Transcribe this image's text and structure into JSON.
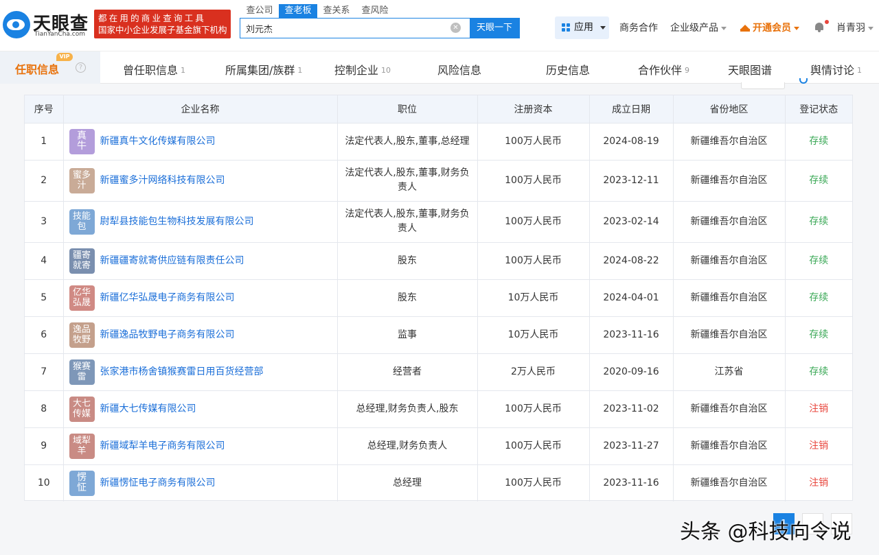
{
  "brand": {
    "name_cn": "天眼查",
    "name_en": "TianYanCha.com",
    "slogan_line1": "都在用的商业查询工具",
    "slogan_line2": "国家中小企业发展子基金旗下机构",
    "accent_color": "#1a82e2",
    "slogan_color": "#d9301f"
  },
  "search": {
    "tabs": [
      "查公司",
      "查老板",
      "查关系",
      "查风险"
    ],
    "active_tab": "查老板",
    "value": "刘元杰",
    "button_label": "天眼一下"
  },
  "nav": {
    "app_label": "应用",
    "biz_coop": "商务合作",
    "enterprise_products": "企业级产品",
    "vip": "开通会员",
    "user_name": "肖青羽"
  },
  "tabs": {
    "current": {
      "label": "任职信息",
      "badge": "VIP"
    },
    "items": [
      {
        "label": "曾任职信息",
        "count": "1"
      },
      {
        "label": "所属集团/族群",
        "count": "1"
      },
      {
        "label": "控制企业",
        "count": "10"
      },
      {
        "label": "风险信息",
        "count": ""
      },
      {
        "label": "历史信息",
        "count": ""
      },
      {
        "label": "合作伙伴",
        "count": "9"
      },
      {
        "label": "天眼图谱",
        "count": ""
      },
      {
        "label": "舆情讨论",
        "count": "1"
      }
    ]
  },
  "table": {
    "columns": [
      "序号",
      "企业名称",
      "职位",
      "注册资本",
      "成立日期",
      "省份地区",
      "登记状态"
    ],
    "rows": [
      {
        "no": "1",
        "avatar": "真牛",
        "avatar_color": "#b39ddb",
        "name": "新疆真牛文化传媒有限公司",
        "role": "法定代表人,股东,董事,总经理",
        "capital": "100万人民币",
        "date": "2024-08-19",
        "region": "新疆维吾尔自治区",
        "status": "存续"
      },
      {
        "no": "2",
        "avatar": "蜜多汁",
        "avatar_color": "#c9ab97",
        "name": "新疆蜜多汁网络科技有限公司",
        "role": "法定代表人,股东,董事,财务负责人",
        "capital": "100万人民币",
        "date": "2023-12-11",
        "region": "新疆维吾尔自治区",
        "status": "存续"
      },
      {
        "no": "3",
        "avatar": "技能包",
        "avatar_color": "#7ea8d6",
        "name": "尉犁县技能包生物科技发展有限公司",
        "role": "法定代表人,股东,董事,财务负责人",
        "capital": "100万人民币",
        "date": "2023-02-14",
        "region": "新疆维吾尔自治区",
        "status": "存续"
      },
      {
        "no": "4",
        "avatar": "疆寄就寄",
        "avatar_color": "#7a8faf",
        "name": "新疆疆寄就寄供应链有限责任公司",
        "role": "股东",
        "capital": "100万人民币",
        "date": "2024-08-22",
        "region": "新疆维吾尔自治区",
        "status": "存续"
      },
      {
        "no": "5",
        "avatar": "亿华弘晟",
        "avatar_color": "#d08a84",
        "name": "新疆亿华弘晟电子商务有限公司",
        "role": "股东",
        "capital": "10万人民币",
        "date": "2024-04-01",
        "region": "新疆维吾尔自治区",
        "status": "存续"
      },
      {
        "no": "6",
        "avatar": "逸品牧野",
        "avatar_color": "#c4a08c",
        "name": "新疆逸品牧野电子商务有限公司",
        "role": "监事",
        "capital": "10万人民币",
        "date": "2023-11-16",
        "region": "新疆维吾尔自治区",
        "status": "存续"
      },
      {
        "no": "7",
        "avatar": "猴赛雷",
        "avatar_color": "#7e97b8",
        "name": "张家港市杨舍镇猴赛雷日用百货经营部",
        "role": "经营者",
        "capital": "2万人民币",
        "date": "2020-09-16",
        "region": "江苏省",
        "status": "存续"
      },
      {
        "no": "8",
        "avatar": "大七传媒",
        "avatar_color": "#c98b84",
        "name": "新疆大七传媒有限公司",
        "role": "总经理,财务负责人,股东",
        "capital": "100万人民币",
        "date": "2023-11-02",
        "region": "新疆维吾尔自治区",
        "status": "注销"
      },
      {
        "no": "9",
        "avatar": "域犁羊",
        "avatar_color": "#c98b84",
        "name": "新疆域犁羊电子商务有限公司",
        "role": "总经理,财务负责人",
        "capital": "100万人民币",
        "date": "2023-11-27",
        "region": "新疆维吾尔自治区",
        "status": "注销"
      },
      {
        "no": "10",
        "avatar": "愣怔",
        "avatar_color": "#7ea8d6",
        "name": "新疆愣怔电子商务有限公司",
        "role": "总经理",
        "capital": "100万人民币",
        "date": "2023-11-16",
        "region": "新疆维吾尔自治区",
        "status": "注销"
      }
    ],
    "status_colors": {
      "存续": "#3aa856",
      "注销": "#e8453c"
    }
  },
  "pagination": {
    "current": "1"
  },
  "watermark": "头条 @科技向令说"
}
